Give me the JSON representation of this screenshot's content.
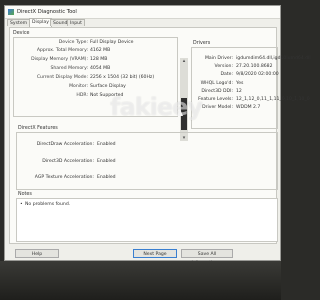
{
  "window": {
    "title": "DirectX Diagnostic Tool"
  },
  "tabs": [
    "System",
    "Display",
    "Sound",
    "Input"
  ],
  "device": {
    "group_title": "Device",
    "rows": [
      {
        "label": "Device Type:",
        "value": "Full Display Device"
      },
      {
        "label": "Approx. Total Memory:",
        "value": "4162 MB"
      },
      {
        "label": "Display Memory (VRAM):",
        "value": "128 MB"
      },
      {
        "label": "Shared Memory:",
        "value": "4054 MB"
      },
      {
        "label": "Current Display Mode:",
        "value": "2256 x 1504 (32 bit) (60Hz)"
      },
      {
        "label": "Monitor:",
        "value": "Surface Display"
      },
      {
        "label": "HDR:",
        "value": "Not Supported"
      }
    ]
  },
  "drivers": {
    "group_title": "Drivers",
    "rows": [
      {
        "label": "Main Driver:",
        "value": "igdumdim64.dll,igd10iumd64.dll"
      },
      {
        "label": "Version:",
        "value": "27.20.100.8682"
      },
      {
        "label": "Date:",
        "value": "9/8/2020 02:00:00"
      },
      {
        "label": "WHQL Logo'd:",
        "value": "Yes"
      },
      {
        "label": "Direct3D DDI:",
        "value": "12"
      },
      {
        "label": "Feature Levels:",
        "value": "12_1,12_0,11_1,11_0,10_1,10_0"
      },
      {
        "label": "Driver Model:",
        "value": "WDDM 2.7"
      }
    ]
  },
  "features": {
    "group_title": "DirectX Features",
    "rows": [
      {
        "label": "DirectDraw Acceleration:",
        "value": "Enabled"
      },
      {
        "label": "Direct3D Acceleration:",
        "value": "Enabled"
      },
      {
        "label": "AGP Texture Acceleration:",
        "value": "Enabled"
      }
    ]
  },
  "notes": {
    "group_title": "Notes",
    "items": [
      "No problems found."
    ]
  },
  "buttons": {
    "help": "Help",
    "next_page": "Next Page",
    "save_all": "Save All Information..."
  },
  "watermark": "fakieey"
}
